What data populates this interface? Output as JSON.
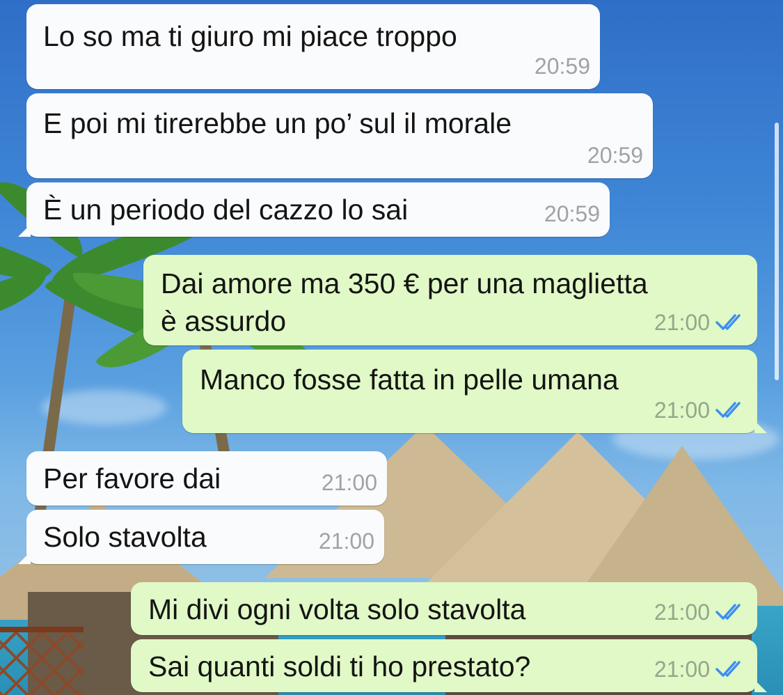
{
  "messages": [
    {
      "direction": "incoming",
      "text": "Lo so ma ti giuro mi piace troppo",
      "time": "20:59"
    },
    {
      "direction": "incoming",
      "text": "E poi mi tirerebbe un po’ sul il morale",
      "time": "20:59"
    },
    {
      "direction": "incoming",
      "text": "È un periodo del cazzo lo sai",
      "time": "20:59"
    },
    {
      "direction": "outgoing",
      "text": "Dai amore ma 350 € per una maglietta\nè assurdo",
      "time": "21:00",
      "status": "read"
    },
    {
      "direction": "outgoing",
      "text": "Manco fosse fatta in pelle umana",
      "time": "21:00",
      "status": "read"
    },
    {
      "direction": "incoming",
      "text": "Per favore dai",
      "time": "21:00"
    },
    {
      "direction": "incoming",
      "text": "Solo stavolta",
      "time": "21:00"
    },
    {
      "direction": "outgoing",
      "text": "Mi divi ogni volta solo stavolta",
      "time": "21:00",
      "status": "read"
    },
    {
      "direction": "outgoing",
      "text": "Sai quanti soldi ti ho prestato?",
      "time": "21:00",
      "status": "read"
    }
  ],
  "colors": {
    "incoming_bubble": "#fafbfd",
    "outgoing_bubble": "#e0f9c6",
    "read_ticks": "#3d8ff0",
    "timestamp": "#9ea3a8"
  },
  "icons": {
    "read_receipt": "double-check-icon"
  }
}
